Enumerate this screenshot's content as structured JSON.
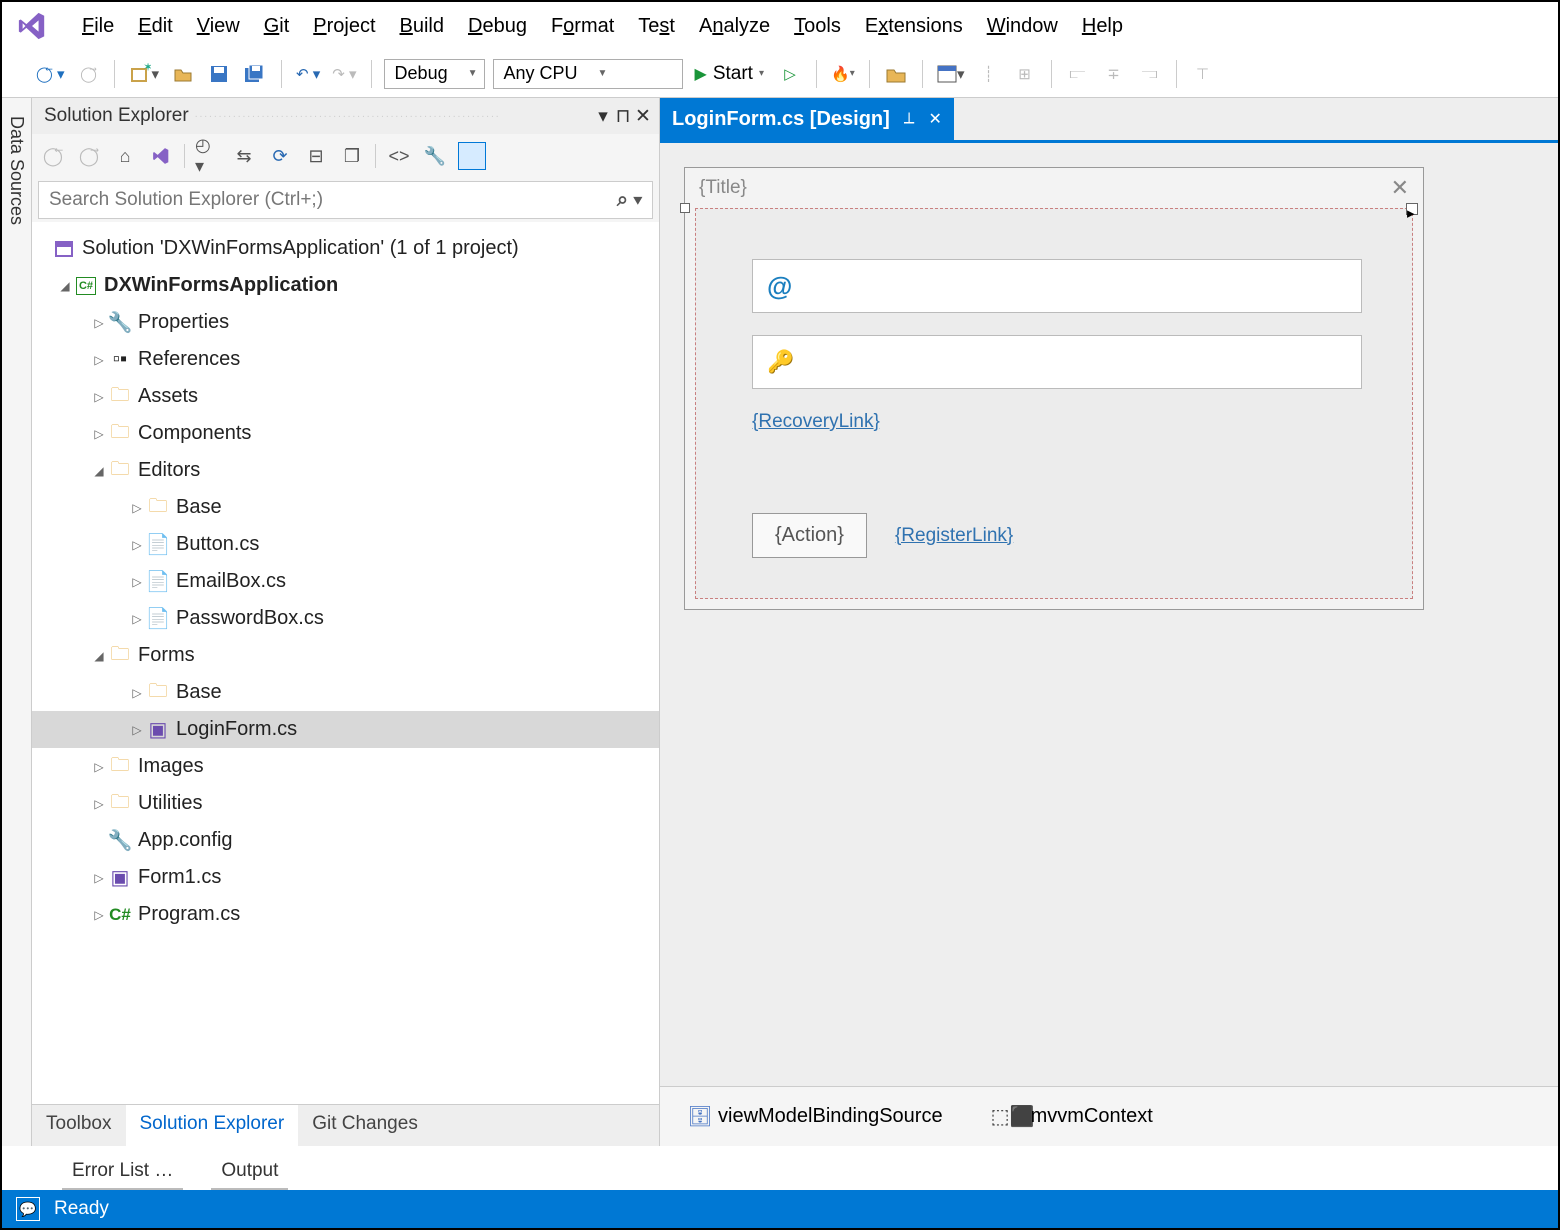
{
  "menu": {
    "file": "File",
    "edit": "Edit",
    "view": "View",
    "git": "Git",
    "project": "Project",
    "build": "Build",
    "debug": "Debug",
    "format": "Format",
    "test": "Test",
    "analyze": "Analyze",
    "tools": "Tools",
    "extensions": "Extensions",
    "window": "Window",
    "help": "Help"
  },
  "toolbar": {
    "config": "Debug",
    "platform": "Any CPU",
    "start": "Start"
  },
  "sidebar_vertical": "Data Sources",
  "solutionExplorer": {
    "title": "Solution Explorer",
    "search_placeholder": "Search Solution Explorer (Ctrl+;)",
    "solution_label": "Solution 'DXWinFormsApplication' (1 of 1 project)",
    "project": "DXWinFormsApplication",
    "nodes": {
      "properties": "Properties",
      "references": "References",
      "assets": "Assets",
      "components": "Components",
      "editors": "Editors",
      "editors_base": "Base",
      "button_cs": "Button.cs",
      "emailbox_cs": "EmailBox.cs",
      "passwordbox_cs": "PasswordBox.cs",
      "forms": "Forms",
      "forms_base": "Base",
      "loginform_cs": "LoginForm.cs",
      "images": "Images",
      "utilities": "Utilities",
      "appconfig": "App.config",
      "form1_cs": "Form1.cs",
      "program_cs": "Program.cs"
    },
    "bottom_tabs": {
      "toolbox": "Toolbox",
      "solExplorer": "Solution Explorer",
      "gitChanges": "Git Changes"
    }
  },
  "docTab": {
    "label": "LoginForm.cs [Design]"
  },
  "designer": {
    "form_title": "{Title}",
    "recovery_link": "{RecoveryLink}",
    "action_button": "{Action}",
    "register_link": "{RegisterLink}"
  },
  "componentTray": {
    "binding": "viewModelBindingSource",
    "mvvm": "mvvmContext"
  },
  "lowerTabs": {
    "errorlist": "Error List …",
    "output": "Output"
  },
  "status": {
    "ready": "Ready"
  }
}
